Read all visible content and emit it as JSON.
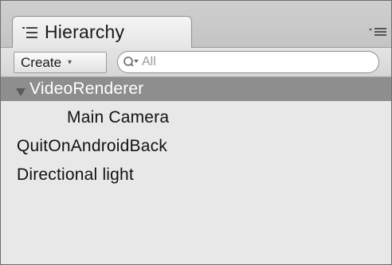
{
  "window": {
    "tab_title": "Hierarchy",
    "tab_icon": "hierarchy-list-icon",
    "panel_menu_icon": "panel-menu-icon"
  },
  "toolbar": {
    "create_label": "Create",
    "create_caret": "▾",
    "search_icon": "search-icon",
    "search_placeholder": "All"
  },
  "tree": {
    "items": [
      {
        "label": "VideoRenderer",
        "depth": 0,
        "expanded": true,
        "selected": true
      },
      {
        "label": "Main Camera",
        "depth": 1,
        "expanded": false,
        "selected": false
      },
      {
        "label": "QuitOnAndroidBack",
        "depth": 0,
        "expanded": false,
        "selected": false
      },
      {
        "label": "Directional light",
        "depth": 0,
        "expanded": false,
        "selected": false
      }
    ]
  },
  "colors": {
    "selection": "#8e8e8e",
    "panel_bg": "#e8e8e8",
    "text": "#111111",
    "selected_text": "#ffffff"
  }
}
